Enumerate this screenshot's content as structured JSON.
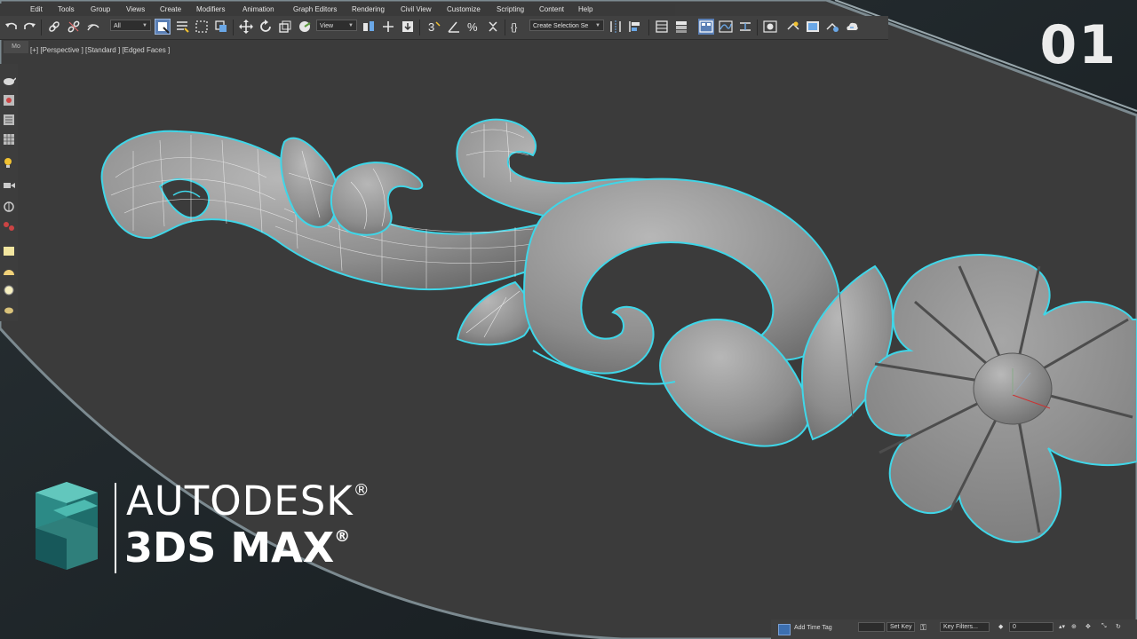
{
  "menu": {
    "items": [
      "Edit",
      "Tools",
      "Group",
      "Views",
      "Create",
      "Modifiers",
      "Animation",
      "Graph Editors",
      "Rendering",
      "Civil View",
      "Customize",
      "Scripting",
      "Content",
      "Help"
    ]
  },
  "toolbar": {
    "filter_dropdown": "All",
    "coord_dropdown": "View",
    "selection_set_dropdown": "Create Selection Se"
  },
  "command_panel": {
    "tab_label": "Mo"
  },
  "viewport": {
    "label": "[+] [Perspective ] [Standard ] [Edged Faces ]"
  },
  "overlay": {
    "episode_number": "01",
    "brand_line1": "AUTODESK",
    "brand_line2": "3DS MAX",
    "registered_mark": "®"
  },
  "statusbar": {
    "add_time_tag": "Add Time Tag",
    "set_key": "Set Key",
    "key_filters": "Key Filters...",
    "frame_value": "0"
  },
  "colors": {
    "viewport_bg": "#3b3b3b",
    "outer_bg": "#1c2226",
    "selection_outline": "#3fd6e8",
    "mesh_fill": "#8e8e8e",
    "logo_teal_light": "#4dbab0",
    "logo_teal_dark": "#1f6e6c"
  },
  "icons": [
    "undo-icon",
    "redo-icon",
    "link-icon",
    "unlink-icon",
    "bind-space-warp-icon",
    "select-object-icon",
    "select-by-name-icon",
    "rect-selection-icon",
    "window-crossing-icon",
    "move-icon",
    "rotate-icon",
    "scale-icon",
    "place-icon",
    "pivot-icon",
    "snap-3d-icon",
    "angle-snap-icon",
    "percent-snap-icon",
    "spinner-snap-icon",
    "edit-named-sets-icon",
    "mirror-icon",
    "align-icon",
    "scene-explorer-icon",
    "layer-explorer-icon",
    "ribbon-icon",
    "curve-editor-icon",
    "schematic-view-icon",
    "material-editor-icon",
    "render-setup-icon",
    "rendered-frame-icon",
    "render-icon",
    "render-cloud-icon"
  ]
}
